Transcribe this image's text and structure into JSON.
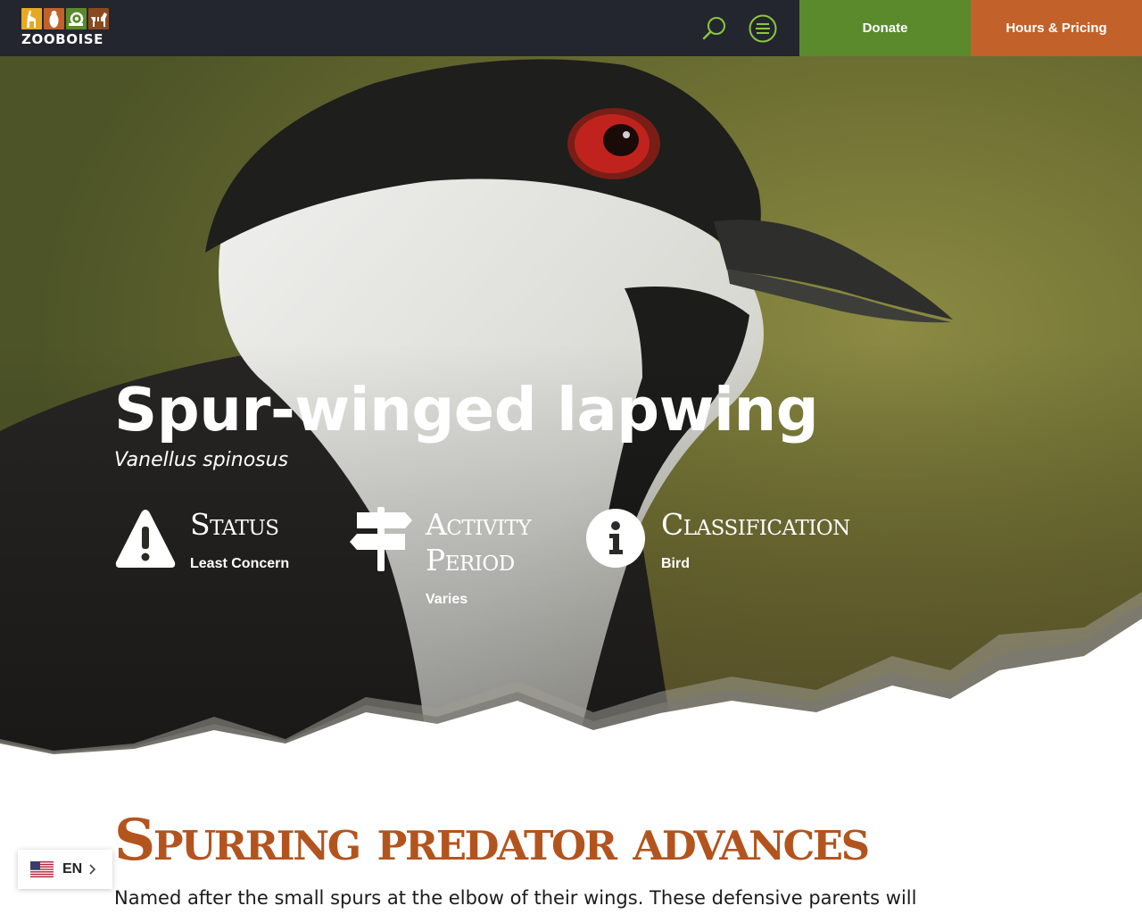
{
  "header": {
    "logo_text": "ZOOBOISE",
    "logo_tile_colors": [
      "#e7a923",
      "#c2612a",
      "#5a8a2c",
      "#8a4a1f"
    ],
    "search_icon": "search-icon",
    "menu_icon": "menu-icon",
    "donate_label": "Donate",
    "hours_label": "Hours & Pricing",
    "colors": {
      "bar": "#23262e",
      "donate": "#5a8a2c",
      "hours": "#c2612a",
      "icon_accent": "#8cc63f"
    }
  },
  "hero": {
    "image": "spur-winged lapwing close-up photo",
    "title": "Spur-winged lapwing",
    "scientific_name": "Vanellus spinosus",
    "facts": [
      {
        "icon": "warning-icon",
        "label": "Status",
        "value": "Least Concern"
      },
      {
        "icon": "signpost-icon",
        "label": "Activity Period",
        "label_line1": "Activity",
        "label_line2": "Period",
        "value": "Varies"
      },
      {
        "icon": "info-icon",
        "label": "Classification",
        "value": "Bird"
      }
    ]
  },
  "content": {
    "heading": "Spurring predator advances",
    "body": "Named after the small spurs at the elbow of their wings. These defensive parents will",
    "heading_color": "#b3541e"
  },
  "language": {
    "flag": "us-flag-icon",
    "code": "EN",
    "chevron": "chevron-right-icon"
  }
}
